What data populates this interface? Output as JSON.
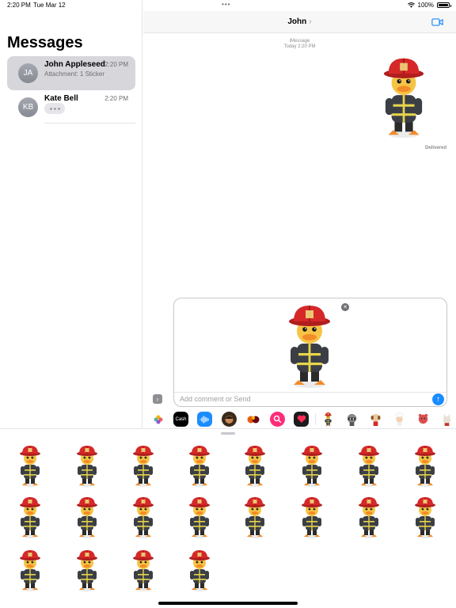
{
  "status_bar": {
    "time": "2:20 PM",
    "date": "Tue Mar 12",
    "battery": "100%"
  },
  "sidebar": {
    "title": "Messages",
    "conversations": [
      {
        "initials": "JA",
        "name": "John Appleseed",
        "time": "2:20 PM",
        "preview": "Attachment: 1 Sticker"
      },
      {
        "initials": "KB",
        "name": "Kate Bell",
        "time": "2:20 PM"
      }
    ]
  },
  "chat": {
    "contact": "John",
    "chevron": "›",
    "service": "iMessage",
    "timestamp": "Today 2:20 PM",
    "status": "Delivered"
  },
  "compose": {
    "placeholder": "Add comment or Send"
  },
  "app_strip": [
    "photos-app",
    "cash-app",
    "audio-app",
    "memoji-app",
    "stickers-app",
    "search-app",
    "heart-app",
    "sticker-pack-1",
    "sticker-pack-2",
    "sticker-pack-3",
    "sticker-pack-4",
    "sticker-pack-5",
    "sticker-pack-6"
  ],
  "app_strip_labels": {
    "cash": "Cash"
  },
  "sticker_count": 20,
  "colors": {
    "accent": "#1a8cff",
    "selected_row": "#d6d6db",
    "duck": "#f6c445",
    "helmet": "#d62828"
  }
}
